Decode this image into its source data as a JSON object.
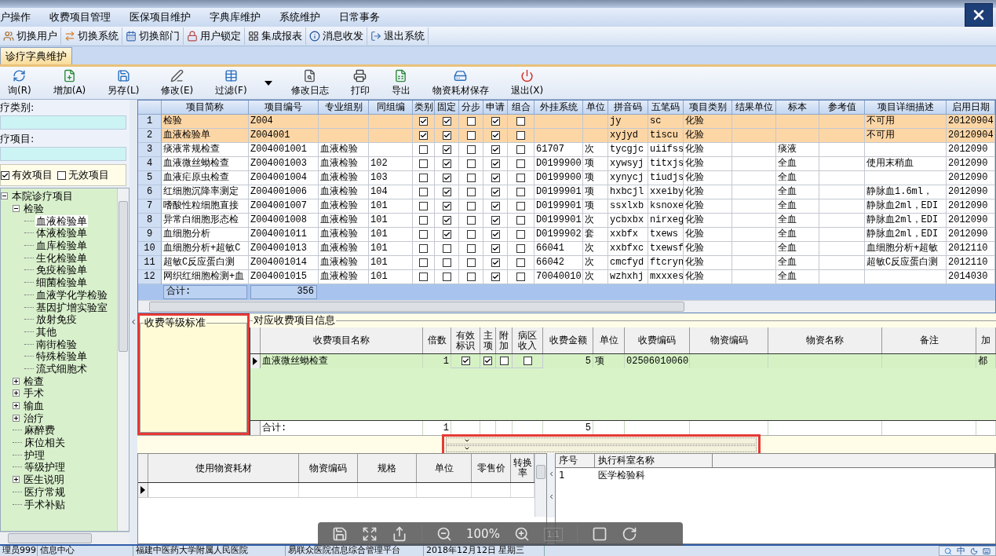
{
  "menu": [
    "户操作",
    "收费项目管理",
    "医保项目维护",
    "字典库维护",
    "系统维护",
    "日常事务"
  ],
  "toolbar": [
    "切换用户",
    "切换系统",
    "切换部门",
    "用户锁定",
    "集成报表",
    "消息收发",
    "退出系统"
  ],
  "tabs": [
    {
      "label": "诊疗字典维护",
      "selected": true
    }
  ],
  "actions": [
    {
      "kind": "button",
      "label": "询(R)"
    },
    {
      "kind": "button",
      "label": "增加(A)"
    },
    {
      "kind": "button",
      "label": "另存(L)"
    },
    {
      "kind": "button",
      "label": "修改(E)"
    },
    {
      "kind": "button",
      "label": "过滤(F)"
    },
    {
      "kind": "dropdown"
    },
    {
      "kind": "button",
      "label": "修改日志"
    },
    {
      "kind": "button",
      "label": "打印"
    },
    {
      "kind": "button",
      "label": "导出"
    },
    {
      "kind": "button",
      "label": "物资耗材保存"
    },
    {
      "kind": "button",
      "label": "退出(X)"
    }
  ],
  "filters": {
    "category_label": "疗类别:",
    "item_label": "疗项目:",
    "options": [
      {
        "label": "有效项目",
        "checked": true
      },
      {
        "label": "无效项目",
        "checked": false
      }
    ]
  },
  "tree": [
    {
      "label": "本院诊疗项目",
      "expanded": true,
      "selected": false,
      "children": [
        {
          "label": "检验",
          "expanded": true,
          "selected": false,
          "children": [
            {
              "label": "血液检验单",
              "selected": true
            },
            {
              "label": "体液检验单",
              "selected": false
            },
            {
              "label": "血库检验单",
              "selected": false
            },
            {
              "label": "生化检验单",
              "selected": false
            },
            {
              "label": "免疫检验单",
              "selected": false
            },
            {
              "label": "细菌检验单",
              "selected": false
            },
            {
              "label": "血液学化学检验",
              "selected": false
            },
            {
              "label": "基因扩增实验室",
              "selected": false
            },
            {
              "label": "放射免疫",
              "selected": false
            },
            {
              "label": "其他",
              "selected": false
            },
            {
              "label": "南街检验",
              "selected": false
            },
            {
              "label": "特殊检验单",
              "selected": false
            },
            {
              "label": "流式细胞术",
              "selected": false
            }
          ]
        },
        {
          "label": "检查",
          "expanded": false,
          "selected": false
        },
        {
          "label": "手术",
          "expanded": false,
          "selected": false
        },
        {
          "label": "输血",
          "expanded": false,
          "selected": false
        },
        {
          "label": "治疗",
          "expanded": false,
          "selected": false
        },
        {
          "label": "麻醉费",
          "selected": false
        },
        {
          "label": "床位相关",
          "selected": false
        },
        {
          "label": "护理",
          "selected": false
        },
        {
          "label": "等级护理",
          "selected": false
        },
        {
          "label": "医生说明",
          "expanded": false,
          "selected": false
        },
        {
          "label": "医疗常规",
          "selected": false
        },
        {
          "label": "手术补贴",
          "selected": false
        }
      ]
    }
  ],
  "table": {
    "columns": [
      {
        "label": "项目简称",
        "kind": "text"
      },
      {
        "label": "项目编号",
        "kind": "text"
      },
      {
        "label": "专业组别",
        "kind": "text"
      },
      {
        "label": "同组编",
        "kind": "text"
      },
      {
        "label": "类别",
        "kind": "check"
      },
      {
        "label": "固定",
        "kind": "check"
      },
      {
        "label": "分步",
        "kind": "check"
      },
      {
        "label": "申请",
        "kind": "check"
      },
      {
        "label": "组合",
        "kind": "check"
      },
      {
        "label": "外挂系统",
        "kind": "text"
      },
      {
        "label": "单位",
        "kind": "text"
      },
      {
        "label": "拼音码",
        "kind": "text"
      },
      {
        "label": "五笔码",
        "kind": "text"
      },
      {
        "label": "项目类别",
        "kind": "text"
      },
      {
        "label": "结果单位",
        "kind": "text"
      },
      {
        "label": "标本",
        "kind": "text"
      },
      {
        "label": "参考值",
        "kind": "text"
      },
      {
        "label": "项目详细描述",
        "kind": "text"
      },
      {
        "label": "启用日期",
        "kind": "text"
      }
    ],
    "rows": [
      {
        "number": "1",
        "highlighted": true,
        "cells": [
          "检验",
          "Z004",
          null,
          null,
          true,
          true,
          false,
          true,
          false,
          null,
          null,
          "jy",
          "sc",
          "化验",
          null,
          null,
          null,
          "不可用",
          "20120904"
        ]
      },
      {
        "number": "2",
        "highlighted": true,
        "cells": [
          "血液检验单",
          "Z004001",
          null,
          null,
          true,
          true,
          false,
          true,
          false,
          null,
          null,
          "xyjyd",
          "tiscu",
          "化验",
          null,
          null,
          null,
          "不可用",
          "20120904"
        ]
      },
      {
        "number": "3",
        "highlighted": false,
        "cells": [
          "痰液常规检查",
          "Z004001001",
          "血液检验",
          null,
          false,
          true,
          false,
          true,
          false,
          "61707",
          "次",
          "tycgjc",
          "uiifss",
          "化验",
          null,
          "痰液",
          null,
          null,
          "2012090"
        ]
      },
      {
        "number": "4",
        "highlighted": false,
        "cells": [
          "血液微丝蚴检查",
          "Z004001003",
          "血液检验",
          "102",
          false,
          true,
          false,
          true,
          false,
          "D0199900",
          "项",
          "xywsyj",
          "titxjs",
          "化验",
          null,
          "全血",
          null,
          "使用末稍血",
          "2012090"
        ]
      },
      {
        "number": "5",
        "highlighted": false,
        "cells": [
          "血液疟原虫检查",
          "Z004001004",
          "血液检验",
          "103",
          false,
          true,
          false,
          true,
          false,
          "D0199900",
          "项",
          "xynycj",
          "tiudjs",
          "化验",
          null,
          "全血",
          null,
          null,
          "2012090"
        ]
      },
      {
        "number": "6",
        "highlighted": false,
        "cells": [
          "红细胞沉降率测定",
          "Z004001006",
          "血液检验",
          "104",
          false,
          true,
          false,
          true,
          false,
          "D0199901",
          "项",
          "hxbcjl",
          "xxeiby",
          "化验",
          null,
          "全血",
          null,
          "静脉血1.6ml，",
          "2012090"
        ]
      },
      {
        "number": "7",
        "highlighted": false,
        "cells": [
          "嗜酸性粒细胞直接",
          "Z004001007",
          "血液检验",
          "101",
          false,
          true,
          false,
          true,
          false,
          "D0199901",
          "项",
          "ssxlxb",
          "ksnoxe",
          "化验",
          null,
          "全血",
          null,
          "静脉血2ml，EDI",
          "2012090"
        ]
      },
      {
        "number": "8",
        "highlighted": false,
        "cells": [
          "异常白细胞形态检",
          "Z004001008",
          "血液检验",
          "101",
          false,
          true,
          false,
          true,
          false,
          "D0199901",
          "次",
          "ycbxbx",
          "nirxeg",
          "化验",
          null,
          "全血",
          null,
          "静脉血2ml，EDI",
          "2012090"
        ]
      },
      {
        "number": "9",
        "highlighted": false,
        "cells": [
          "血细胞分析",
          "Z004001011",
          "血液检验",
          "101",
          false,
          true,
          false,
          true,
          false,
          "D0199902",
          "套",
          "xxbfx",
          "txews",
          "化验",
          null,
          "全血",
          null,
          "静脉血2ml，EDI",
          "2012090"
        ]
      },
      {
        "number": "10",
        "highlighted": false,
        "cells": [
          "血细胞分析+超敏C",
          "Z004001013",
          "血液检验",
          "101",
          false,
          false,
          false,
          true,
          false,
          "66041",
          "次",
          "xxbfxc",
          "txewsf",
          "化验",
          null,
          "全血",
          null,
          "血细胞分析+超敏",
          "2012110"
        ]
      },
      {
        "number": "11",
        "highlighted": false,
        "cells": [
          "超敏C反应蛋白测",
          "Z004001014",
          "血液检验",
          "101",
          false,
          false,
          false,
          true,
          false,
          "66042",
          "次",
          "cmcfyd",
          "ftcryn",
          "化验",
          null,
          "全血",
          null,
          "超敏C反应蛋白测",
          "2012110"
        ]
      },
      {
        "number": "12",
        "highlighted": false,
        "cells": [
          "网织红细胞检测+血",
          "Z004001015",
          "血液检验",
          "101",
          false,
          false,
          false,
          true,
          false,
          "70040010",
          "次",
          "wzhxhj",
          "mxxxes",
          "化验",
          null,
          "全血",
          null,
          null,
          "2014030"
        ]
      }
    ],
    "footer_label": "合计:",
    "footer_total": "356"
  },
  "grade_panel": {
    "title": "收费等级标准"
  },
  "charge_panel": {
    "title": "对应收费项目信息",
    "columns": [
      {
        "label": "收费项目名称",
        "kind": "text"
      },
      {
        "label": "倍数",
        "kind": "number",
        "total": "1"
      },
      {
        "label": "有效标识",
        "kind": "check"
      },
      {
        "label": "主项",
        "kind": "check"
      },
      {
        "label": "附加",
        "kind": "check"
      },
      {
        "label": "病区收入",
        "kind": "check"
      },
      {
        "label": "收费金额",
        "kind": "number",
        "total": "5"
      },
      {
        "label": "单位",
        "kind": "text"
      },
      {
        "label": "收费编码",
        "kind": "text"
      },
      {
        "label": "物资编码",
        "kind": "text"
      },
      {
        "label": "物资名称",
        "kind": "text"
      },
      {
        "label": "备注",
        "kind": "text"
      },
      {
        "label": "加",
        "kind": "text"
      }
    ],
    "rows": [
      {
        "cells": [
          "血液微丝蚴检查",
          "1",
          true,
          true,
          false,
          false,
          "5",
          "项",
          "02506010060",
          null,
          null,
          null,
          "都"
        ]
      }
    ],
    "total_label": "合计:"
  },
  "materials": {
    "columns": [
      "使用物资耗材",
      "物资编码",
      "规格",
      "单位",
      "零售价",
      "转换率"
    ]
  },
  "departments": {
    "columns": [
      "序号",
      "执行科室名称"
    ],
    "rows": [
      [
        "1",
        "医学检验科"
      ]
    ]
  },
  "viewer": {
    "zoom": "100%",
    "actual_size": "1:1"
  },
  "status_bar": [
    "理员999",
    "信息中心",
    "福建中医药大学附属人民医院",
    "易联众医院信息综合管理平台",
    "2018年12月12日 星期三"
  ],
  "ime": {
    "mode": "中"
  }
}
